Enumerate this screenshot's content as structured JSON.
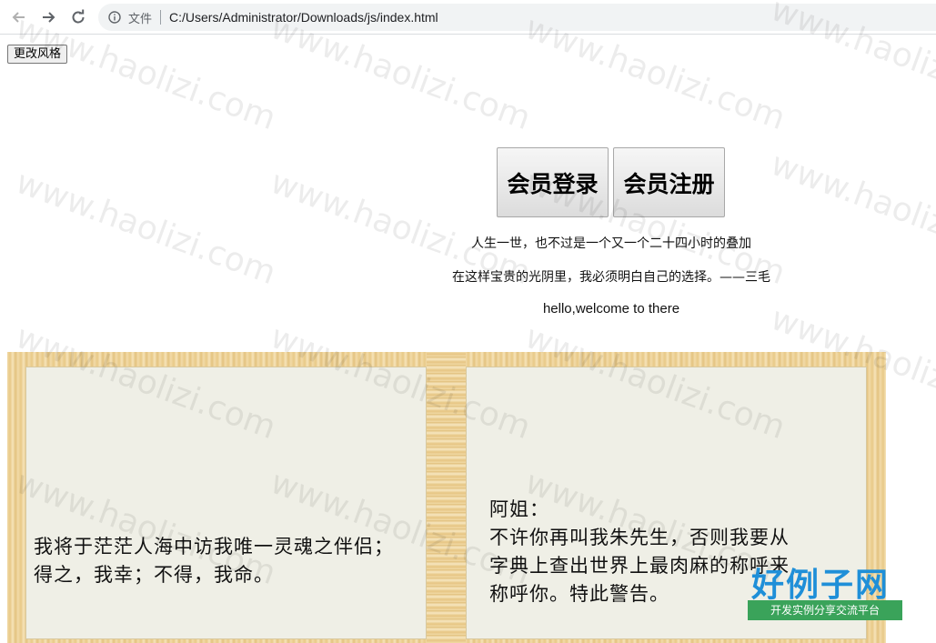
{
  "browser": {
    "scheme_label": "文件",
    "url": "C:/Users/Administrator/Downloads/js/index.html",
    "icons": [
      "back-arrow-icon",
      "forward-arrow-icon",
      "reload-icon",
      "info-icon"
    ]
  },
  "page": {
    "style_button_label": "更改风格",
    "login_button_label": "会员登录",
    "register_button_label": "会员注册",
    "quote_line1": "人生一世，也不过是一个又一个二十四小时的叠加",
    "quote_line2": "在这样宝贵的光阴里，我必须明白自己的选择。——三毛",
    "greeting": "hello,welcome to there",
    "book": {
      "left_page_text": "我将于茫茫人海中访我唯一灵魂之伴侣；\n得之，我幸；不得，我命。",
      "right_page_text": "阿姐：\n不许你再叫我朱先生，否则我要从\n字典上查出世界上最肉麻的称呼来\n称呼你。特此警告。"
    }
  },
  "watermark_text": "www.haolizi.com",
  "logo": {
    "title": "好例子网",
    "subtitle": "开发实例分享交流平台"
  }
}
